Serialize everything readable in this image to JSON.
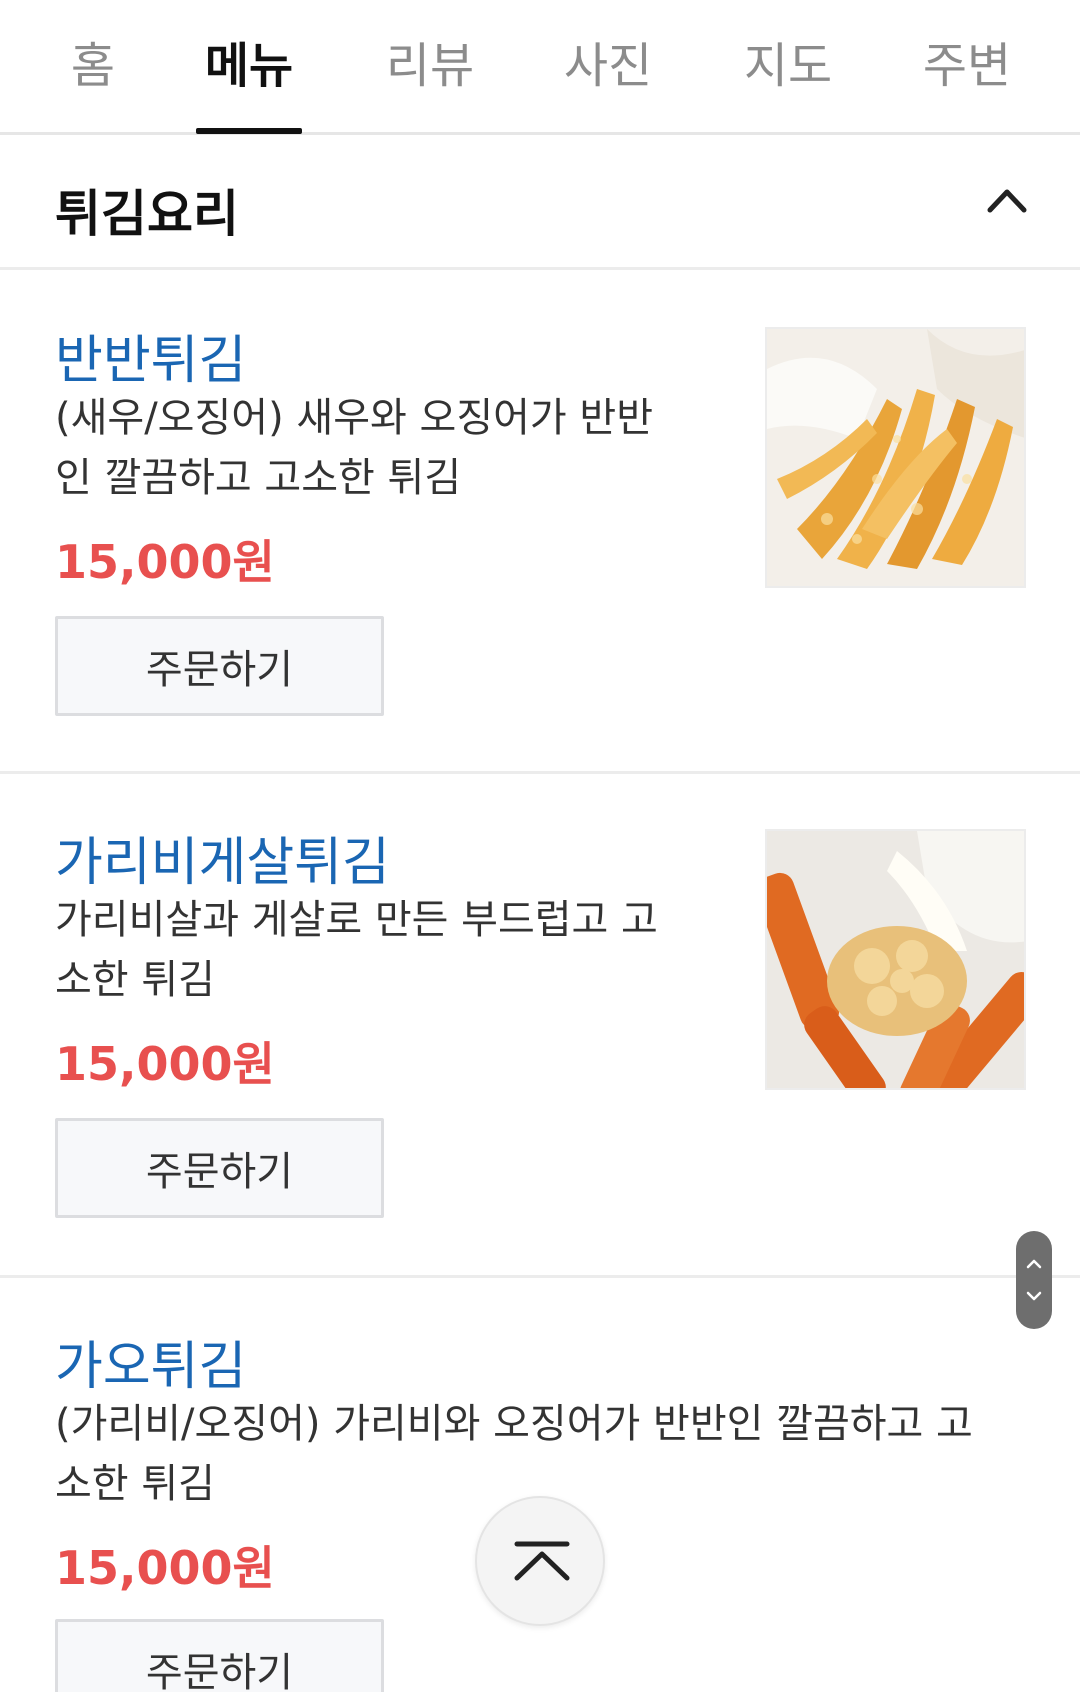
{
  "tabs": [
    {
      "label": "홈",
      "active": false
    },
    {
      "label": "메뉴",
      "active": true
    },
    {
      "label": "리뷰",
      "active": false
    },
    {
      "label": "사진",
      "active": false
    },
    {
      "label": "지도",
      "active": false
    },
    {
      "label": "주변",
      "active": false
    }
  ],
  "section": {
    "title": "튀김요리",
    "collapse_icon": "chevron-up-icon"
  },
  "items": [
    {
      "name": "반반튀김",
      "desc_line1": "(새우/오징어) 새우와 오징어가 반반",
      "desc_line2": "인 깔끔하고 고소한 튀김",
      "price": "15,000원",
      "order_label": "주문하기",
      "image": "shrimp-squid-tempura-photo"
    },
    {
      "name": "가리비게살튀김",
      "desc_line1": "가리비살과 게살로 만든 부드럽고 고",
      "desc_line2": "소한 튀김",
      "price": "15,000원",
      "order_label": "주문하기",
      "image": "scallop-crab-fritter-photo"
    },
    {
      "name": "가오튀김",
      "desc_line1": "(가리비/오징어) 가리비와 오징어가 반반인 깔끔하고 고",
      "desc_line2": "소한 튀김",
      "price": "15,000원",
      "order_label": "주문하기"
    }
  ],
  "colors": {
    "accent_name": "#1a66b3",
    "price": "#e8504f",
    "active_tab": "#111111",
    "inactive_tab": "#8c8c8c"
  },
  "controls": {
    "scroll_handle_icons": [
      "chevron-up-icon",
      "chevron-down-icon"
    ],
    "back_to_top_icon": "back-to-top-icon"
  }
}
